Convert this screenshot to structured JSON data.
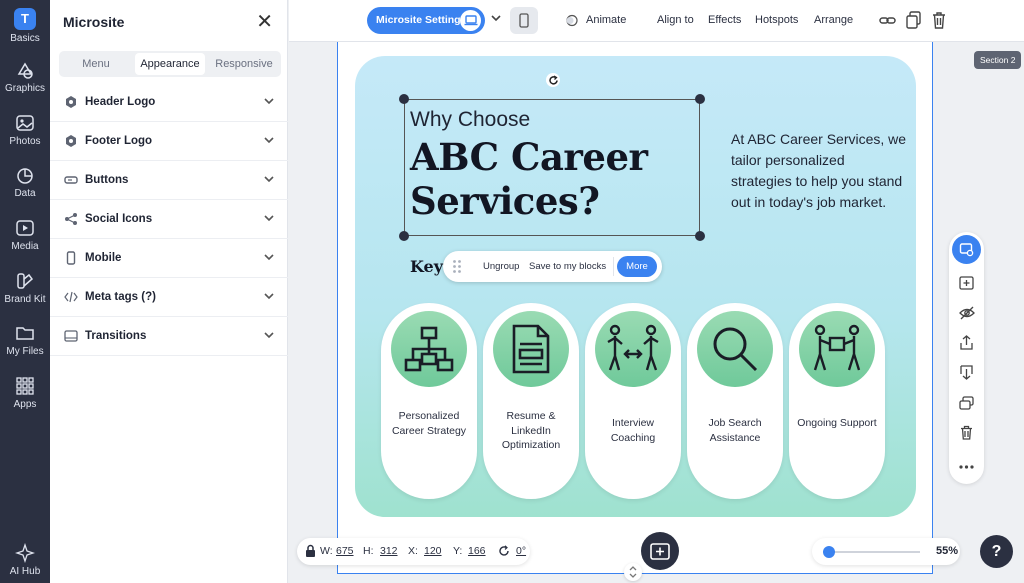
{
  "rail": {
    "items": [
      {
        "label": "Basics",
        "icon": "t-logo-icon",
        "glyph": "T"
      },
      {
        "label": "Graphics",
        "icon": "shapes-icon"
      },
      {
        "label": "Photos",
        "icon": "photo-icon"
      },
      {
        "label": "Data",
        "icon": "chart-icon"
      },
      {
        "label": "Media",
        "icon": "media-icon"
      },
      {
        "label": "Brand Kit",
        "icon": "brand-kit-icon"
      },
      {
        "label": "My Files",
        "icon": "folder-icon"
      },
      {
        "label": "Apps",
        "icon": "apps-grid-icon"
      },
      {
        "label": "AI Hub",
        "icon": "sparkle-icon"
      }
    ]
  },
  "panel": {
    "title": "Microsite",
    "tabs": [
      {
        "label": "Menu"
      },
      {
        "label": "Appearance"
      },
      {
        "label": "Responsive"
      }
    ],
    "sections": [
      {
        "label": "Header Logo",
        "icon": "hexagon-icon"
      },
      {
        "label": "Footer Logo",
        "icon": "hexagon-icon"
      },
      {
        "label": "Buttons",
        "icon": "button-shape-icon"
      },
      {
        "label": "Social Icons",
        "icon": "share-icon"
      },
      {
        "label": "Mobile",
        "icon": "mobile-icon"
      },
      {
        "label": "Meta tags (?)",
        "icon": "code-icon"
      },
      {
        "label": "Transitions",
        "icon": "transitions-icon"
      }
    ]
  },
  "toolbar": {
    "microsite_settings": "Microsite Settings",
    "animate": "Animate",
    "align_to": "Align to",
    "effects": "Effects",
    "hotspots": "Hotspots",
    "arrange": "Arrange"
  },
  "canvas": {
    "section_badge": "Section 2",
    "why": "Why Choose",
    "headline": "ABC Career Services?",
    "intro": "At ABC Career Services, we tailor personalized strategies to help you stand out in today's job market.",
    "key": "Key",
    "context_menu": {
      "ungroup": "Ungroup",
      "save": "Save to my blocks",
      "more": "More"
    },
    "services": [
      {
        "label": "Personalized Career Strategy",
        "icon": "org-chart-icon"
      },
      {
        "label": "Resume & LinkedIn Optimization",
        "icon": "document-icon"
      },
      {
        "label": "Interview Coaching",
        "icon": "interview-icon"
      },
      {
        "label": "Job Search Assistance",
        "icon": "magnifier-icon"
      },
      {
        "label": "Ongoing Support",
        "icon": "support-icon"
      }
    ]
  },
  "dims": {
    "w_label": "W:",
    "w": "675",
    "h_label": "H:",
    "h": "312",
    "x_label": "X:",
    "x": "120",
    "y_label": "Y:",
    "y": "166",
    "rot": "0°"
  },
  "zoom": {
    "value": "55%",
    "level": 0.05
  },
  "help": "?",
  "colors": {
    "accent": "#3a82f0",
    "rail": "#2b3041",
    "mint": "#7fd0a6"
  }
}
